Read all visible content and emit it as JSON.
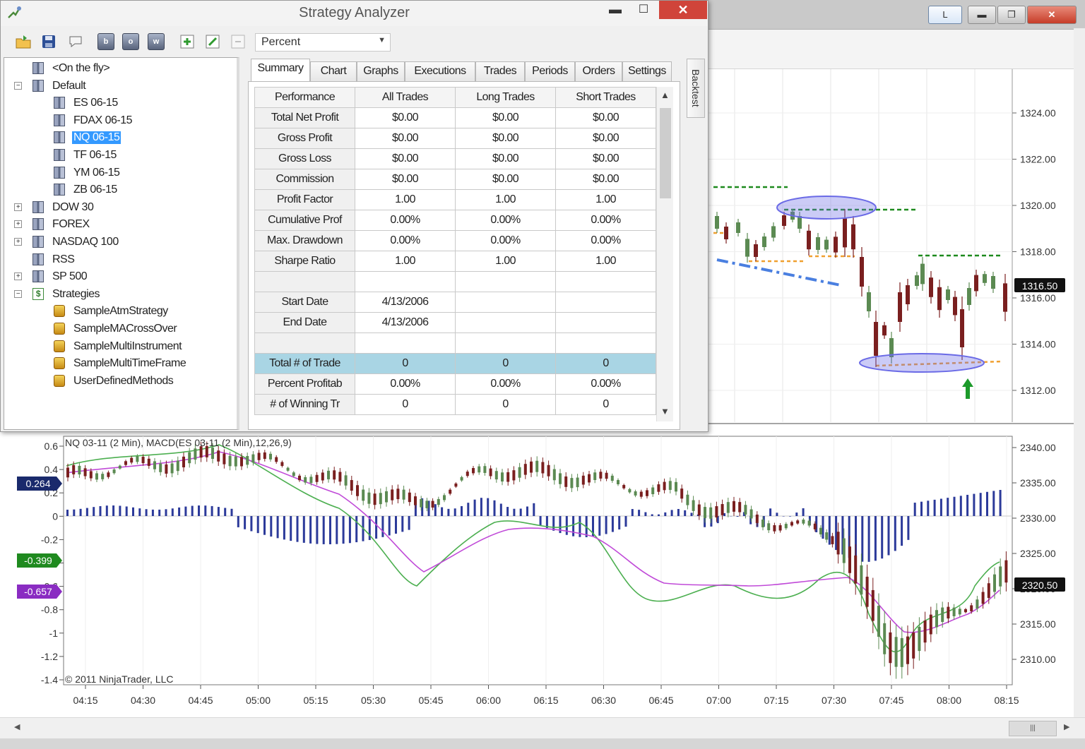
{
  "window": {
    "title": "Strategy Analyzer",
    "minimize_glyph": "▬",
    "maximize_glyph": "☐",
    "close_glyph": "✕"
  },
  "chart_window": {
    "link_button": "L"
  },
  "toolbar": {
    "icons": [
      "open-folder-icon",
      "save-icon",
      "chat-icon",
      "backtest-b-icon",
      "optimize-o-icon",
      "walkforward-w-icon",
      "add-icon",
      "edit-icon",
      "delete-icon"
    ],
    "letters": [
      "b",
      "o",
      "w"
    ],
    "display_mode": "Percent"
  },
  "tree": {
    "items": [
      {
        "label": "<On the fly>",
        "level": 1,
        "icon": "instrument-list",
        "expander": ""
      },
      {
        "label": "Default",
        "level": 0,
        "icon": "instrument-list",
        "expander": "−"
      },
      {
        "label": "ES 06-15",
        "level": 2,
        "icon": "instrument",
        "expander": ""
      },
      {
        "label": "FDAX 06-15",
        "level": 2,
        "icon": "instrument",
        "expander": ""
      },
      {
        "label": "NQ 06-15",
        "level": 2,
        "icon": "instrument",
        "expander": "",
        "selected": true
      },
      {
        "label": "TF 06-15",
        "level": 2,
        "icon": "instrument",
        "expander": ""
      },
      {
        "label": "YM 06-15",
        "level": 2,
        "icon": "instrument",
        "expander": ""
      },
      {
        "label": "ZB 06-15",
        "level": 2,
        "icon": "instrument",
        "expander": ""
      },
      {
        "label": "DOW 30",
        "level": 0,
        "icon": "instrument-list",
        "expander": "+"
      },
      {
        "label": "FOREX",
        "level": 0,
        "icon": "instrument-list",
        "expander": "+"
      },
      {
        "label": "NASDAQ 100",
        "level": 0,
        "icon": "instrument-list",
        "expander": "+"
      },
      {
        "label": "RSS",
        "level": 1,
        "icon": "instrument-list",
        "expander": ""
      },
      {
        "label": "SP 500",
        "level": 0,
        "icon": "instrument-list",
        "expander": "+"
      },
      {
        "label": "Strategies",
        "level": 0,
        "icon": "dollar",
        "expander": "−"
      },
      {
        "label": "SampleAtmStrategy",
        "level": 2,
        "icon": "strategy",
        "expander": ""
      },
      {
        "label": "SampleMACrossOver",
        "level": 2,
        "icon": "strategy",
        "expander": ""
      },
      {
        "label": "SampleMultiInstrument",
        "level": 2,
        "icon": "strategy",
        "expander": ""
      },
      {
        "label": "SampleMultiTimeFrame",
        "level": 2,
        "icon": "strategy",
        "expander": ""
      },
      {
        "label": "UserDefinedMethods",
        "level": 2,
        "icon": "strategy",
        "expander": ""
      }
    ]
  },
  "tabs": [
    "Summary",
    "Chart",
    "Graphs",
    "Executions",
    "Trades",
    "Periods",
    "Orders",
    "Settings"
  ],
  "active_tab": "Summary",
  "side_tab": "Backtest",
  "summary_table": {
    "columns": [
      "Performance",
      "All Trades",
      "Long Trades",
      "Short Trades"
    ],
    "rows": [
      [
        "Total Net Profit",
        "$0.00",
        "$0.00",
        "$0.00"
      ],
      [
        "Gross Profit",
        "$0.00",
        "$0.00",
        "$0.00"
      ],
      [
        "Gross Loss",
        "$0.00",
        "$0.00",
        "$0.00"
      ],
      [
        "Commission",
        "$0.00",
        "$0.00",
        "$0.00"
      ],
      [
        "Profit Factor",
        "1.00",
        "1.00",
        "1.00"
      ],
      [
        "Cumulative Prof",
        "0.00%",
        "0.00%",
        "0.00%"
      ],
      [
        "Max. Drawdown",
        "0.00%",
        "0.00%",
        "0.00%"
      ],
      [
        "Sharpe Ratio",
        "1.00",
        "1.00",
        "1.00"
      ],
      [
        "",
        "",
        "",
        ""
      ],
      [
        "Start Date",
        "4/13/2006",
        "",
        ""
      ],
      [
        "End Date",
        "4/13/2006",
        "",
        ""
      ],
      [
        "",
        "",
        "",
        ""
      ],
      [
        "Total # of Trade",
        "0",
        "0",
        "0"
      ],
      [
        "Percent Profitab",
        "0.00%",
        "0.00%",
        "0.00%"
      ],
      [
        "# of Winning Tr",
        "0",
        "0",
        "0"
      ]
    ],
    "highlighted_row": 12
  },
  "upper_chart": {
    "y_ticks": [
      "1324.00",
      "1322.00",
      "1320.00",
      "1318.00",
      "1316.00",
      "1314.00",
      "1312.00"
    ],
    "last_price": "1316.50",
    "colors": {
      "up": "#5b8a52",
      "down": "#7a1f1f",
      "target": "#1d8a1d",
      "stop": "#f0a030",
      "trend": "#4a7fe0",
      "ellipse": "#6a6ae6"
    }
  },
  "lower_chart": {
    "label": "NQ 03-11 (2 Min), MACD(ES 03-11 (2 Min),12,26,9)",
    "copyright": "© 2011 NinjaTrader, LLC",
    "left_ticks": [
      "0.6",
      "0.4",
      "0.2",
      "0",
      "-0.2",
      "-0.4",
      "-0.6",
      "-0.8",
      "-1",
      "-1.2",
      "-1.4"
    ],
    "right_ticks": [
      "2340.00",
      "2335.00",
      "2330.00",
      "2325.00",
      "2320.00",
      "2315.00",
      "2310.00"
    ],
    "x_ticks": [
      "04:15",
      "04:30",
      "04:45",
      "05:00",
      "05:15",
      "05:30",
      "05:45",
      "06:00",
      "06:15",
      "06:30",
      "06:45",
      "07:00",
      "07:15",
      "07:30",
      "07:45",
      "08:00",
      "08:15"
    ],
    "badges": [
      {
        "text": "0.264",
        "color": "#1a2a6c"
      },
      {
        "text": "-0.399",
        "color": "#1f8a1f"
      },
      {
        "text": "-0.657",
        "color": "#8a2cc2"
      }
    ],
    "last_price": "2320.50",
    "colors": {
      "macd": "#4caf50",
      "signal": "#c04ad8",
      "histogram": "#2c3a9a",
      "up": "#5b8a52",
      "down": "#7a1f1f"
    }
  }
}
